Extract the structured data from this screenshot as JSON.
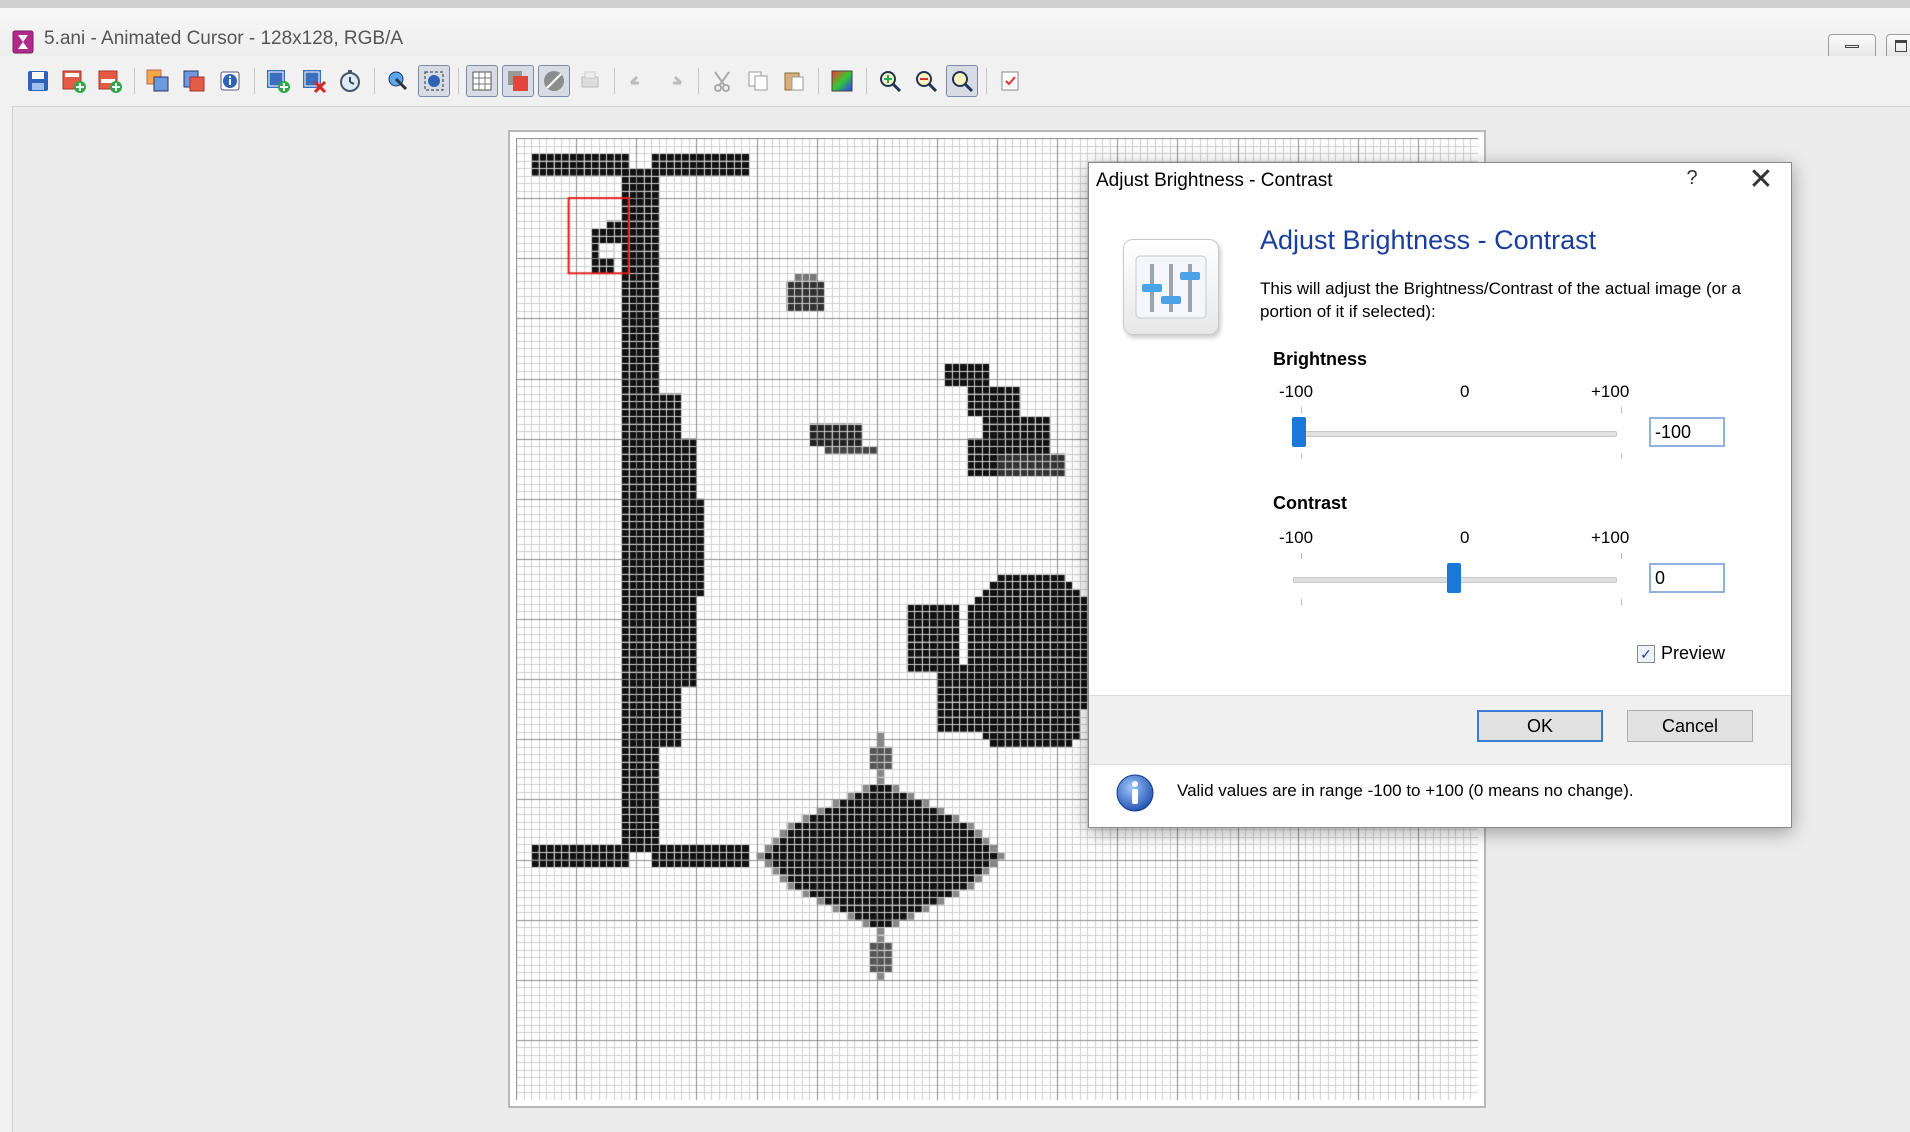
{
  "window": {
    "title": "5.ani - Animated Cursor - 128x128, RGB/A"
  },
  "toolbar": {
    "buttons": [
      {
        "icon": "save-icon",
        "pressed": false
      },
      {
        "icon": "new-frame-icon",
        "pressed": false
      },
      {
        "icon": "insert-frame-icon",
        "pressed": false
      },
      {
        "icon": "copy-frames-icon",
        "pressed": false
      },
      {
        "icon": "frame-list-icon",
        "pressed": false
      },
      {
        "icon": "info-icon",
        "pressed": false
      },
      {
        "icon": "add-image-icon",
        "pressed": false
      },
      {
        "icon": "delete-image-icon",
        "pressed": false
      },
      {
        "icon": "timer-icon",
        "pressed": false
      },
      {
        "icon": "hotspot-icon",
        "pressed": false
      },
      {
        "icon": "select-all-icon",
        "pressed": true
      },
      {
        "icon": "grid-icon",
        "pressed": true
      },
      {
        "icon": "color-mask-icon",
        "pressed": true
      },
      {
        "icon": "transparency-icon",
        "pressed": true
      },
      {
        "icon": "print-icon",
        "pressed": false
      },
      {
        "icon": "undo-icon",
        "pressed": false
      },
      {
        "icon": "redo-icon",
        "pressed": false
      },
      {
        "icon": "cut-icon",
        "pressed": false
      },
      {
        "icon": "copy-icon",
        "pressed": false
      },
      {
        "icon": "paste-icon",
        "pressed": false
      },
      {
        "icon": "palette-icon",
        "pressed": false
      },
      {
        "icon": "zoom-in-icon",
        "pressed": false
      },
      {
        "icon": "zoom-out-icon",
        "pressed": false
      },
      {
        "icon": "zoom-tool-icon",
        "pressed": true
      },
      {
        "icon": "test-cursor-icon",
        "pressed": false
      }
    ]
  },
  "dialog": {
    "title": "Adjust Brightness - Contrast",
    "help": "?",
    "close": "✕",
    "heading": "Adjust Brightness - Contrast",
    "description": "This will adjust the Brightness/Contrast of the actual image (or a portion of it if selected):",
    "scale": {
      "min": "-100",
      "mid": "0",
      "max": "+100"
    },
    "brightness": {
      "label": "Brightness",
      "value": "-100",
      "slider_fraction": 0
    },
    "contrast": {
      "label": "Contrast",
      "value": "0",
      "slider_fraction": 0.5
    },
    "preview": {
      "label": "Preview",
      "checked": true
    },
    "ok_label": "OK",
    "cancel_label": "Cancel",
    "info_text": "Valid values are in range -100 to +100 (0 means no change)."
  },
  "colors": {
    "accent": "#1b78d8",
    "heading": "#1a3e9e"
  }
}
